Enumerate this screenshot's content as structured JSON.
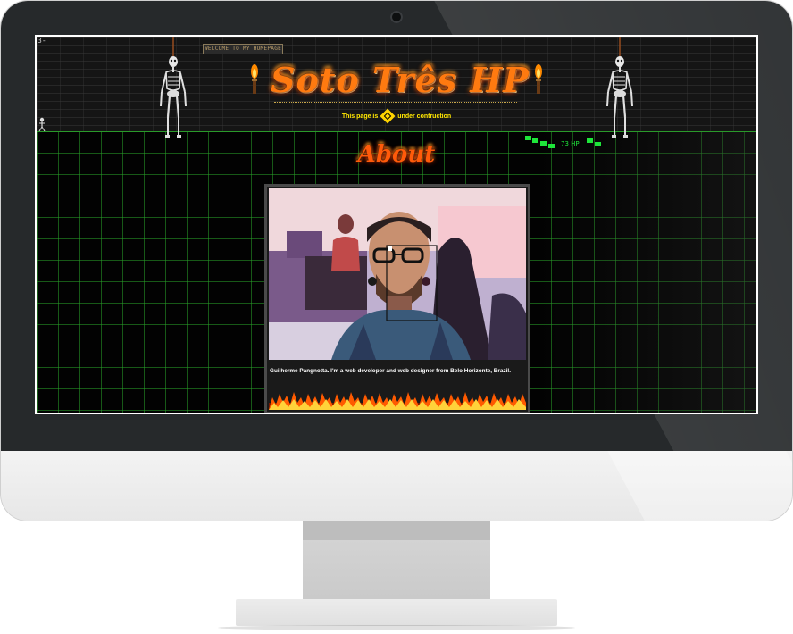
{
  "site": {
    "corner_mark": "3-",
    "welcome_button": "WELCOME TO MY HOMEPAGE",
    "title": "Soto Três HP",
    "construction": {
      "before": "This page is",
      "after": "under contruction"
    },
    "decor_text": "73 HP",
    "about_heading": "About",
    "bio": "Guilherme Pangnotta. I'm a web developer and web designer from Belo Horizonte, Brazil."
  },
  "icons": [
    "skeleton-icon",
    "torch-icon",
    "construction-sign-icon",
    "fire-border"
  ],
  "colors": {
    "title_fire": "#ff7a10",
    "construction_text": "#ffe600",
    "grid_line": "#28a028",
    "monitor_bezel": "#26292b"
  }
}
